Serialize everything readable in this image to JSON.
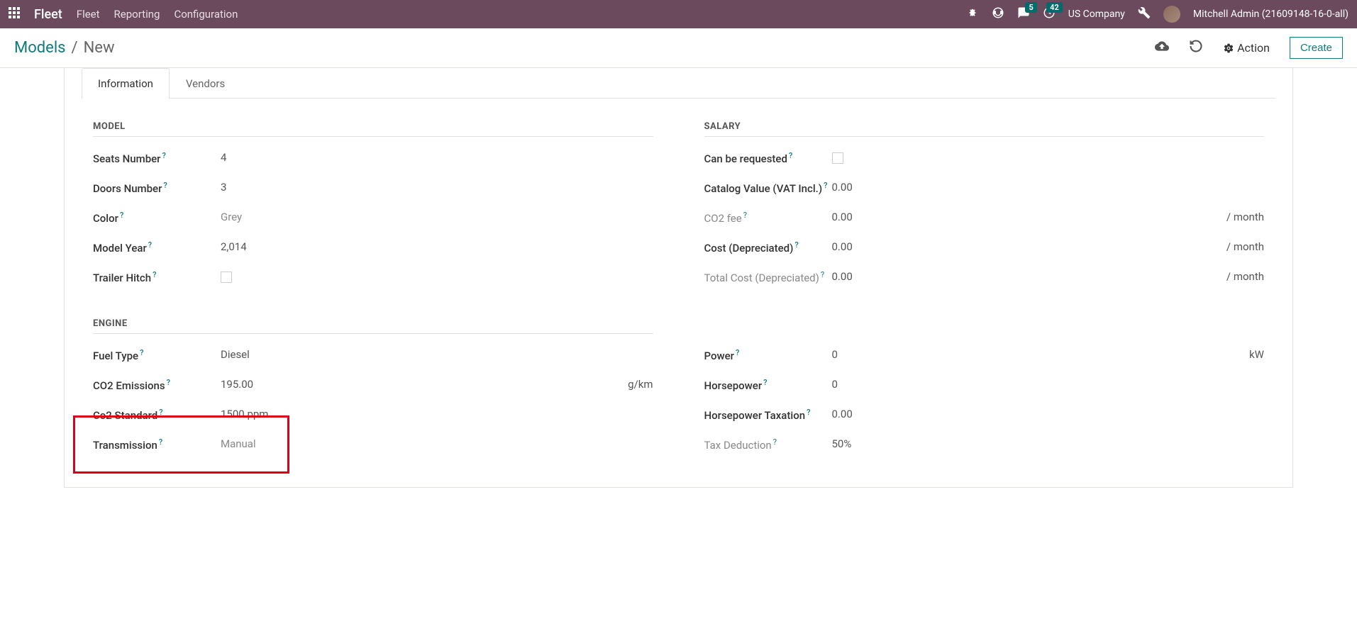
{
  "navbar": {
    "brand": "Fleet",
    "links": [
      "Fleet",
      "Reporting",
      "Configuration"
    ],
    "msg_badge": "5",
    "activity_badge": "42",
    "company": "US Company",
    "user": "Mitchell Admin (21609148-16-0-all)"
  },
  "breadcrumb": {
    "parent": "Models",
    "current": "New"
  },
  "cp": {
    "action": "Action",
    "create": "Create"
  },
  "tabs": {
    "info": "Information",
    "vendors": "Vendors"
  },
  "sections": {
    "model": "MODEL",
    "salary": "SALARY",
    "engine": "ENGINE"
  },
  "model": {
    "seats_label": "Seats Number",
    "seats_value": "4",
    "doors_label": "Doors Number",
    "doors_value": "3",
    "color_label": "Color",
    "color_value": "Grey",
    "year_label": "Model Year",
    "year_value": "2,014",
    "trailer_label": "Trailer Hitch"
  },
  "salary": {
    "req_label": "Can be requested",
    "catalog_label": "Catalog Value (VAT Incl.)",
    "catalog_value": "0.00",
    "co2fee_label": "CO2 fee",
    "co2fee_value": "0.00",
    "cost_label": "Cost (Depreciated)",
    "cost_value": "0.00",
    "total_label": "Total Cost (Depreciated)",
    "total_value": "0.00",
    "unit_month": "/ month"
  },
  "engine": {
    "fuel_label": "Fuel Type",
    "fuel_value": "Diesel",
    "co2e_label": "CO2 Emissions",
    "co2e_value": "195.00",
    "co2e_unit": "g/km",
    "co2s_label": "Co2 Standard",
    "co2s_value": "1500 ppm",
    "trans_label": "Transmission",
    "trans_value": "Manual",
    "power_label": "Power",
    "power_value": "0",
    "power_unit": "kW",
    "hp_label": "Horsepower",
    "hp_value": "0",
    "hptax_label": "Horsepower Taxation",
    "hptax_value": "0.00",
    "taxded_label": "Tax Deduction",
    "taxded_value": "50%"
  }
}
